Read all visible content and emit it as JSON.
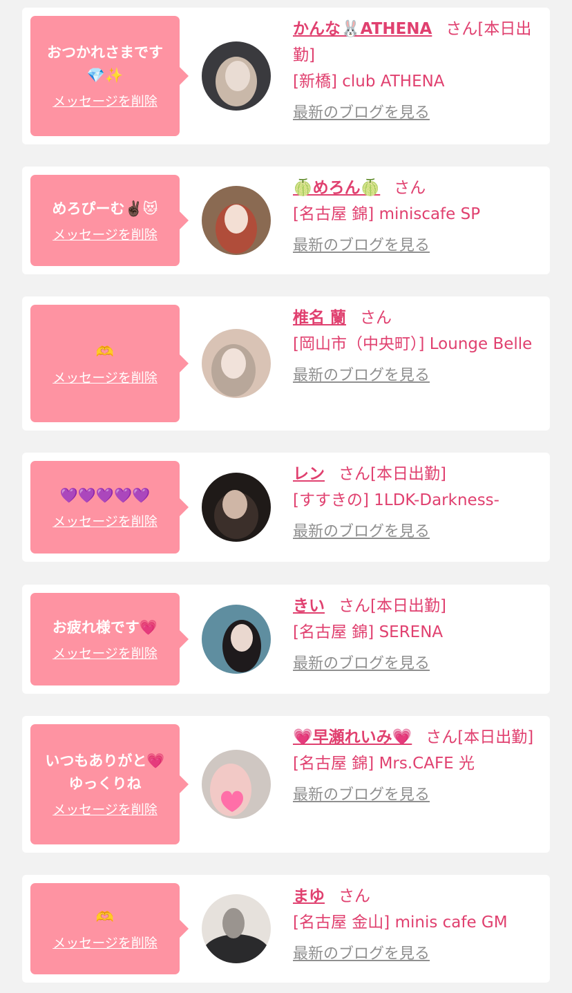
{
  "cards": [
    {
      "message": "おつかれさまです\n💎✨",
      "delete_label": "メッセージを削除",
      "name": "かんな🐰ATHENA",
      "suffix": "さん[本日出勤]",
      "shop": "[新橋] club ATHENA",
      "blog_label": "最新のブログを見る",
      "avatar_colors": [
        "#3a3a3e",
        "#e9dcd3",
        "#c9b8a9"
      ]
    },
    {
      "message": "めろぴーむ✌🏿😻",
      "delete_label": "メッセージを削除",
      "name": "🍈めろん🍈",
      "suffix": "さん",
      "shop": "[名古屋 錦] miniscafe SP",
      "blog_label": "最新のブログを見る",
      "avatar_colors": [
        "#8a6a52",
        "#f3dfd4",
        "#b04d3a"
      ]
    },
    {
      "message": "🫶",
      "delete_label": "メッセージを削除",
      "name": "椎名 蘭",
      "suffix": "さん",
      "shop": "[岡山市（中央町）] Lounge Belle",
      "blog_label": "最新のブログを見る",
      "avatar_colors": [
        "#b8a79a",
        "#f1e2da",
        "#d9c3b5"
      ]
    },
    {
      "message": "💜💜💜💜💜",
      "delete_label": "メッセージを削除",
      "name": "レン",
      "suffix": "さん[本日出勤]",
      "shop": "[すすきの] 1LDK-Darkness-",
      "blog_label": "最新のブログを見る",
      "avatar_colors": [
        "#1f1a18",
        "#cfb6a6",
        "#3b2f2a"
      ]
    },
    {
      "message": "お疲れ様です💗",
      "delete_label": "メッセージを削除",
      "name": "きい",
      "suffix": "さん[本日出勤]",
      "shop": "[名古屋 錦] SERENA",
      "blog_label": "最新のブログを見る",
      "avatar_colors": [
        "#5f8ea0",
        "#ead8cf",
        "#1e1a1c"
      ]
    },
    {
      "message": "いつもありがと💗\nゆっくりね",
      "delete_label": "メッセージを削除",
      "name": "💗早瀬れいみ💗",
      "suffix": "さん[本日出勤]",
      "shop": "[名古屋 錦] Mrs.CAFE 光",
      "blog_label": "最新のブログを見る",
      "avatar_colors": [
        "#cfc7c2",
        "#f2c9c6",
        "#ff6fa8"
      ]
    },
    {
      "message": "🫶",
      "delete_label": "メッセージを削除",
      "name": "まゆ",
      "suffix": "さん",
      "shop": "[名古屋 金山] minis cafe GM",
      "blog_label": "最新のブログを見る",
      "avatar_colors": [
        "#2a2a2c",
        "#e6e1dc",
        "#9a948f"
      ]
    }
  ]
}
